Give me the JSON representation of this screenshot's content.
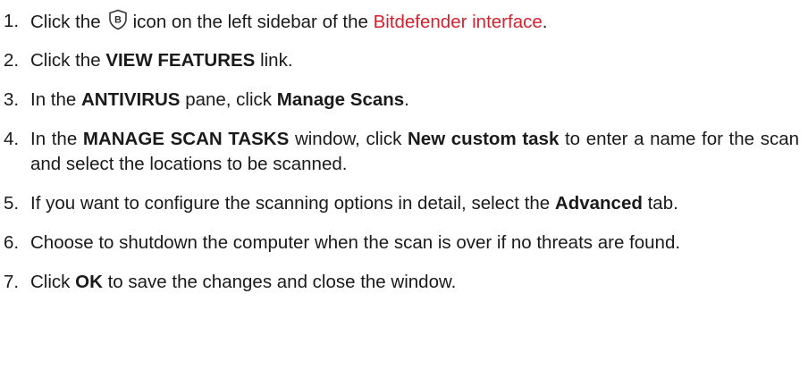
{
  "steps": [
    {
      "number": "1.",
      "pre": "Click the",
      "icon": "bitdefender-shield-b-icon",
      "mid": "icon on the left sidebar of the",
      "link": "Bitdefender interface",
      "post": "."
    },
    {
      "number": "2.",
      "pre": "Click the",
      "bold": "VIEW FEATURES",
      "post": "link."
    },
    {
      "number": "3.",
      "pre": "In the",
      "bold1": "ANTIVIRUS",
      "mid": "pane, click",
      "bold2": "Manage Scans",
      "post": "."
    },
    {
      "number": "4.",
      "pre": "In the",
      "bold1": "MANAGE SCAN TASKS",
      "mid": "window, click",
      "bold2": "New custom task",
      "post": "to enter a name for the scan and select the locations to be scanned."
    },
    {
      "number": "5.",
      "pre": "If you want to configure the scanning options in detail, select the",
      "bold": "Advanced",
      "post": "tab."
    },
    {
      "number": "6.",
      "text": "Choose to shutdown the computer when the scan is over if no threats are found."
    },
    {
      "number": "7.",
      "pre": "Click",
      "bold": "OK",
      "post": "to save the changes and close the window."
    }
  ],
  "colors": {
    "text": "#1a1a1a",
    "link": "#d5222f"
  }
}
